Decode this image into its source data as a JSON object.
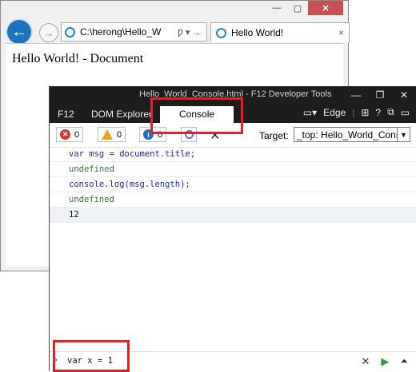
{
  "browser": {
    "window_controls": [
      "—",
      "▢",
      "✕"
    ],
    "address": "C:\\herong\\Hello_W",
    "address_tools": "Ƿ ▾ →",
    "tab_title": "Hello World!",
    "tab_close": "×",
    "document_text": "Hello World! - Document"
  },
  "devtools": {
    "title": "Hello_World_Console.html - F12 Developer Tools",
    "window_controls": [
      "—",
      "❐",
      "✕"
    ],
    "tabs": [
      "F12",
      "DOM Explorer",
      "Console"
    ],
    "active_tab": "Console",
    "mode_label": "Edge",
    "toolbar_icons": [
      "▭▾",
      "⊞",
      "?",
      "⧉",
      "▭"
    ],
    "console": {
      "error_count": "0",
      "warning_count": "0",
      "info_count": "0",
      "target_label": "Target:",
      "target_value": "_top: Hello_World_Cons",
      "lines": [
        {
          "type": "input",
          "text": "var msg = document.title;"
        },
        {
          "type": "result",
          "text": "undefined"
        },
        {
          "type": "input",
          "text": "console.log(msg.length);"
        },
        {
          "type": "result",
          "text": "undefined"
        },
        {
          "type": "log",
          "text": "12"
        }
      ],
      "input_prompt": "›",
      "input_value": "var x = 1"
    }
  }
}
